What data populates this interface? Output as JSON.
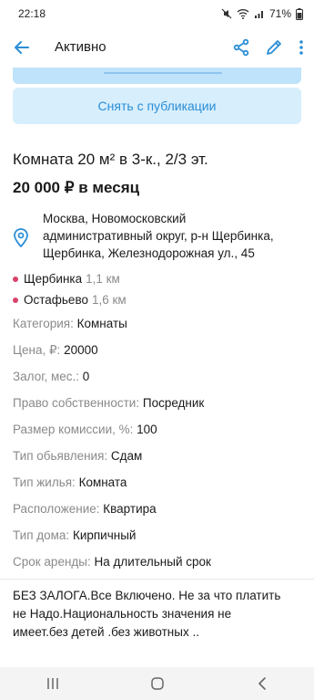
{
  "status_bar": {
    "time": "22:18",
    "battery": "71%"
  },
  "app_bar": {
    "title": "Активно",
    "back_icon": "arrow-left-icon",
    "share_icon": "share-icon",
    "edit_icon": "pencil-icon",
    "more_icon": "more-vert-icon"
  },
  "colors": {
    "accent": "#2b8ed6",
    "button_bg": "#d7eefc",
    "metro_dot": "#d8426a",
    "muted": "#8a8a8a"
  },
  "actions": {
    "unpublish_label": "Снять с публикации"
  },
  "listing": {
    "title": "Комната 20 м² в 3-к., 2/3 эт.",
    "price": "20 000 ₽ в месяц",
    "address_lines": [
      "Москва, Новомосковский",
      "административный округ, р-н Щербинка,",
      "Щербинка, Железнодорожная ул., 45"
    ],
    "metro": [
      {
        "name": "Щербинка",
        "distance": "1,1 км"
      },
      {
        "name": "Остафьево",
        "distance": "1,6 км"
      }
    ],
    "properties": [
      {
        "label": "Категория:",
        "value": "Комнаты"
      },
      {
        "label": "Цена, ₽:",
        "value": "20000"
      },
      {
        "label": "Залог, мес.:",
        "value": "0"
      },
      {
        "label": "Право собственности:",
        "value": "Посредник"
      },
      {
        "label": "Размер комиссии, %:",
        "value": "100"
      },
      {
        "label": "Тип обьявления:",
        "value": "Сдам"
      },
      {
        "label": "Тип жилья:",
        "value": "Комната"
      },
      {
        "label": "Расположение:",
        "value": "Квартира"
      },
      {
        "label": "Тип дома:",
        "value": "Кирпичный"
      },
      {
        "label": "Срок аренды:",
        "value": "На длительный срок"
      }
    ],
    "description_lines": [
      "БЕЗ ЗАЛОГА.Все Включено. Не за что платить",
      "не Надо.Национальность значения не",
      "имеет.без детей .без животных .."
    ]
  }
}
